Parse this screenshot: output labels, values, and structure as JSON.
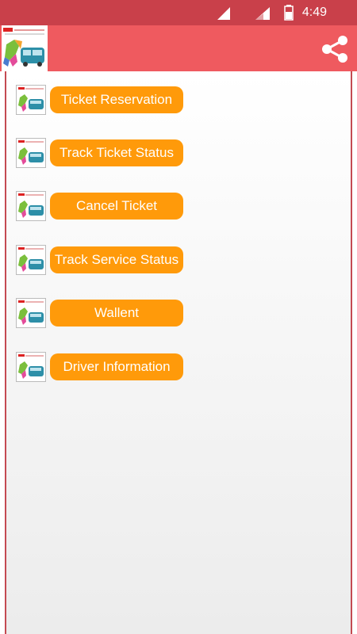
{
  "status_bar": {
    "time": "4:49",
    "icons": [
      "signal-icon",
      "wifi-icon",
      "battery-icon"
    ]
  },
  "app_bar": {
    "logo_title": "Ticket Reservation",
    "share_icon": "share-icon",
    "background_color": "#ef5a5f"
  },
  "menu": {
    "items": [
      {
        "label": "Ticket Reservation"
      },
      {
        "label": "Track Ticket Status"
      },
      {
        "label": "Cancel Ticket"
      },
      {
        "label": "Track Service Status"
      },
      {
        "label": "Wallent"
      },
      {
        "label": "Driver Information"
      }
    ],
    "button_color": "#ff9a0a"
  }
}
